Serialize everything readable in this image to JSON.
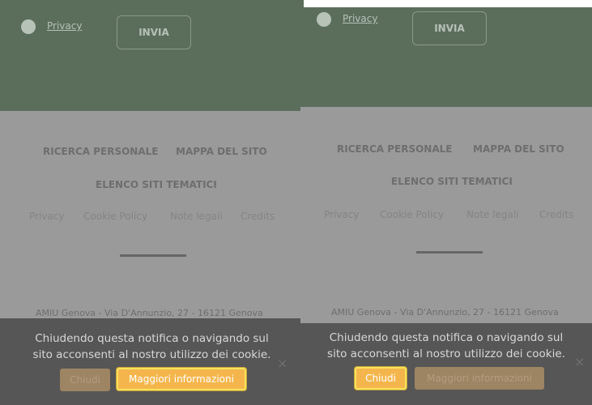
{
  "left": {
    "privacy_label": "Privacy",
    "send_label": "INVIA",
    "nav": [
      "RICERCA PERSONALE",
      "MAPPA DEL SITO",
      "ELENCO SITI TEMATICI"
    ],
    "footer_links": [
      "Privacy",
      "Cookie Policy",
      "Note legali",
      "Credits"
    ],
    "address": "AMIU Genova - Via D'Annunzio, 27 - 16121 Genova",
    "cookie_text_1": "Chiudendo questa notifica o navigando sul",
    "cookie_text_2": "sito acconsenti al nostro utilizzo dei cookie.",
    "close_button": "Chiudi",
    "more_info_button": "Maggiori informazioni",
    "close_icon": "×"
  },
  "right": {
    "privacy_label": "Privacy",
    "send_label": "INVIA",
    "nav": [
      "RICERCA PERSONALE",
      "MAPPA DEL SITO",
      "ELENCO SITI TEMATICI"
    ],
    "footer_links": [
      "Privacy",
      "Cookie Policy",
      "Note legali",
      "Credits"
    ],
    "address": "AMIU Genova - Via D'Annunzio, 27 - 16121 Genova",
    "cookie_text_1": "Chiudendo questa notifica o navigando sul",
    "cookie_text_2": "sito acconsenti al nostro utilizzo dei cookie.",
    "close_button": "Chiudi",
    "more_info_button": "Maggiori informazioni",
    "close_icon": "×"
  },
  "colors": {
    "header_green": "#5b6e5c",
    "overlay_gray": "#9a9a9a",
    "cookie_bar": "#565656",
    "highlight_button": "#f4b64c"
  }
}
